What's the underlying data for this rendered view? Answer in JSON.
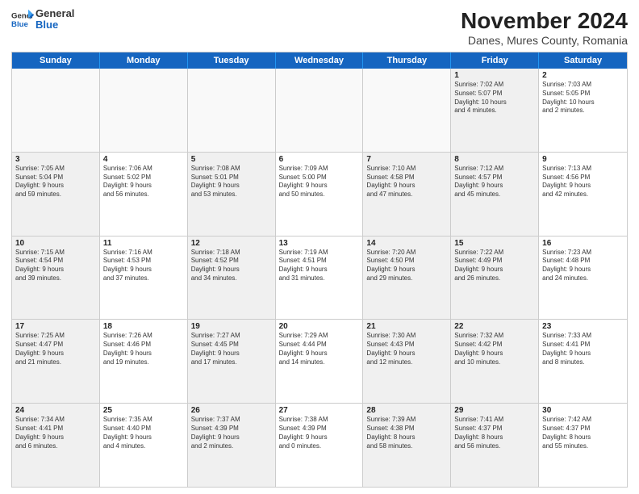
{
  "header": {
    "logo": {
      "line1": "General",
      "line2": "Blue"
    },
    "title": "November 2024",
    "location": "Danes, Mures County, Romania"
  },
  "weekdays": [
    "Sunday",
    "Monday",
    "Tuesday",
    "Wednesday",
    "Thursday",
    "Friday",
    "Saturday"
  ],
  "rows": [
    {
      "cells": [
        {
          "empty": true
        },
        {
          "empty": true
        },
        {
          "empty": true
        },
        {
          "empty": true
        },
        {
          "empty": true
        },
        {
          "day": 1,
          "shaded": true,
          "info": "Sunrise: 7:02 AM\nSunset: 5:07 PM\nDaylight: 10 hours\nand 4 minutes."
        },
        {
          "day": 2,
          "shaded": false,
          "info": "Sunrise: 7:03 AM\nSunset: 5:05 PM\nDaylight: 10 hours\nand 2 minutes."
        }
      ]
    },
    {
      "cells": [
        {
          "day": 3,
          "shaded": true,
          "info": "Sunrise: 7:05 AM\nSunset: 5:04 PM\nDaylight: 9 hours\nand 59 minutes."
        },
        {
          "day": 4,
          "shaded": false,
          "info": "Sunrise: 7:06 AM\nSunset: 5:02 PM\nDaylight: 9 hours\nand 56 minutes."
        },
        {
          "day": 5,
          "shaded": true,
          "info": "Sunrise: 7:08 AM\nSunset: 5:01 PM\nDaylight: 9 hours\nand 53 minutes."
        },
        {
          "day": 6,
          "shaded": false,
          "info": "Sunrise: 7:09 AM\nSunset: 5:00 PM\nDaylight: 9 hours\nand 50 minutes."
        },
        {
          "day": 7,
          "shaded": true,
          "info": "Sunrise: 7:10 AM\nSunset: 4:58 PM\nDaylight: 9 hours\nand 47 minutes."
        },
        {
          "day": 8,
          "shaded": true,
          "info": "Sunrise: 7:12 AM\nSunset: 4:57 PM\nDaylight: 9 hours\nand 45 minutes."
        },
        {
          "day": 9,
          "shaded": false,
          "info": "Sunrise: 7:13 AM\nSunset: 4:56 PM\nDaylight: 9 hours\nand 42 minutes."
        }
      ]
    },
    {
      "cells": [
        {
          "day": 10,
          "shaded": true,
          "info": "Sunrise: 7:15 AM\nSunset: 4:54 PM\nDaylight: 9 hours\nand 39 minutes."
        },
        {
          "day": 11,
          "shaded": false,
          "info": "Sunrise: 7:16 AM\nSunset: 4:53 PM\nDaylight: 9 hours\nand 37 minutes."
        },
        {
          "day": 12,
          "shaded": true,
          "info": "Sunrise: 7:18 AM\nSunset: 4:52 PM\nDaylight: 9 hours\nand 34 minutes."
        },
        {
          "day": 13,
          "shaded": false,
          "info": "Sunrise: 7:19 AM\nSunset: 4:51 PM\nDaylight: 9 hours\nand 31 minutes."
        },
        {
          "day": 14,
          "shaded": true,
          "info": "Sunrise: 7:20 AM\nSunset: 4:50 PM\nDaylight: 9 hours\nand 29 minutes."
        },
        {
          "day": 15,
          "shaded": true,
          "info": "Sunrise: 7:22 AM\nSunset: 4:49 PM\nDaylight: 9 hours\nand 26 minutes."
        },
        {
          "day": 16,
          "shaded": false,
          "info": "Sunrise: 7:23 AM\nSunset: 4:48 PM\nDaylight: 9 hours\nand 24 minutes."
        }
      ]
    },
    {
      "cells": [
        {
          "day": 17,
          "shaded": true,
          "info": "Sunrise: 7:25 AM\nSunset: 4:47 PM\nDaylight: 9 hours\nand 21 minutes."
        },
        {
          "day": 18,
          "shaded": false,
          "info": "Sunrise: 7:26 AM\nSunset: 4:46 PM\nDaylight: 9 hours\nand 19 minutes."
        },
        {
          "day": 19,
          "shaded": true,
          "info": "Sunrise: 7:27 AM\nSunset: 4:45 PM\nDaylight: 9 hours\nand 17 minutes."
        },
        {
          "day": 20,
          "shaded": false,
          "info": "Sunrise: 7:29 AM\nSunset: 4:44 PM\nDaylight: 9 hours\nand 14 minutes."
        },
        {
          "day": 21,
          "shaded": true,
          "info": "Sunrise: 7:30 AM\nSunset: 4:43 PM\nDaylight: 9 hours\nand 12 minutes."
        },
        {
          "day": 22,
          "shaded": true,
          "info": "Sunrise: 7:32 AM\nSunset: 4:42 PM\nDaylight: 9 hours\nand 10 minutes."
        },
        {
          "day": 23,
          "shaded": false,
          "info": "Sunrise: 7:33 AM\nSunset: 4:41 PM\nDaylight: 9 hours\nand 8 minutes."
        }
      ]
    },
    {
      "cells": [
        {
          "day": 24,
          "shaded": true,
          "info": "Sunrise: 7:34 AM\nSunset: 4:41 PM\nDaylight: 9 hours\nand 6 minutes."
        },
        {
          "day": 25,
          "shaded": false,
          "info": "Sunrise: 7:35 AM\nSunset: 4:40 PM\nDaylight: 9 hours\nand 4 minutes."
        },
        {
          "day": 26,
          "shaded": true,
          "info": "Sunrise: 7:37 AM\nSunset: 4:39 PM\nDaylight: 9 hours\nand 2 minutes."
        },
        {
          "day": 27,
          "shaded": false,
          "info": "Sunrise: 7:38 AM\nSunset: 4:39 PM\nDaylight: 9 hours\nand 0 minutes."
        },
        {
          "day": 28,
          "shaded": true,
          "info": "Sunrise: 7:39 AM\nSunset: 4:38 PM\nDaylight: 8 hours\nand 58 minutes."
        },
        {
          "day": 29,
          "shaded": true,
          "info": "Sunrise: 7:41 AM\nSunset: 4:37 PM\nDaylight: 8 hours\nand 56 minutes."
        },
        {
          "day": 30,
          "shaded": false,
          "info": "Sunrise: 7:42 AM\nSunset: 4:37 PM\nDaylight: 8 hours\nand 55 minutes."
        }
      ]
    }
  ]
}
